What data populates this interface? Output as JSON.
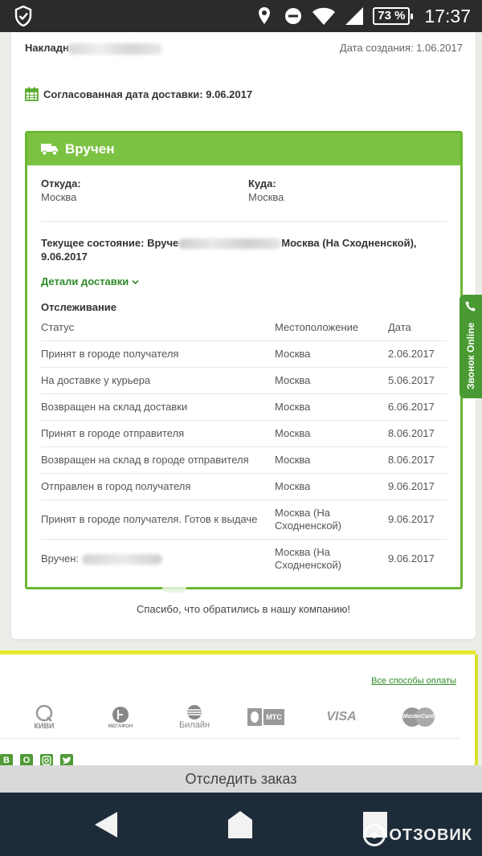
{
  "status_bar": {
    "battery": "73 %",
    "time": "17:37"
  },
  "order": {
    "invoice_label": "Накладн",
    "created": "Дата создания: 1.06.2017",
    "agreed_delivery": "Согласованная дата доставки: 9.06.2017",
    "status_title": "Вручен",
    "from_label": "Откуда:",
    "from_value": "Москва",
    "to_label": "Куда:",
    "to_value": "Москва",
    "current_state_prefix": "Текущее состояние: Вруче",
    "current_state_suffix": "Москва (На Сходненской), 9.06.2017",
    "details_link": "Детали доставки",
    "tracking_title": "Отслеживание",
    "thanks": "Спасибо, что обратились в нашу компанию!"
  },
  "tracking": {
    "headers": [
      "Статус",
      "Местоположение",
      "Дата"
    ],
    "rows": [
      {
        "status": "Принят в городе получателя",
        "location": "Москва",
        "date": "2.06.2017"
      },
      {
        "status": "На доставке у курьера",
        "location": "Москва",
        "date": "5.06.2017"
      },
      {
        "status": "Возвращен на склад доставки",
        "location": "Москва",
        "date": "6.06.2017"
      },
      {
        "status": "Принят в городе отправителя",
        "location": "Москва",
        "date": "8.06.2017"
      },
      {
        "status": "Возвращен на склад в городе отправителя",
        "location": "Москва",
        "date": "8.06.2017"
      },
      {
        "status": "Отправлен в город получателя",
        "location": "Москва",
        "date": "9.06.2017"
      },
      {
        "status": "Принят в городе получателя. Готов к выдаче",
        "location": "Москва (На Сходненской)",
        "date": "9.06.2017"
      },
      {
        "status": "Вручен:",
        "location": "Москва (На Сходненской)",
        "date": "9.06.2017"
      }
    ]
  },
  "call_tab": {
    "label": "Звонок Online"
  },
  "footer": {
    "payment_link": "Все способы оплаты",
    "logos": [
      "КИВИ",
      "МЕГАФОН",
      "Билайн",
      "МТС",
      "VISA",
      "MasterCard"
    ],
    "social": [
      "В",
      "О",
      "И",
      "Т"
    ]
  },
  "track_button": "Отследить заказ",
  "watermark": "ОТЗОВИК",
  "colors": {
    "accent_green": "#7cc242",
    "link_green": "#2f8a2a",
    "nav_bg": "#1e2c3a"
  }
}
